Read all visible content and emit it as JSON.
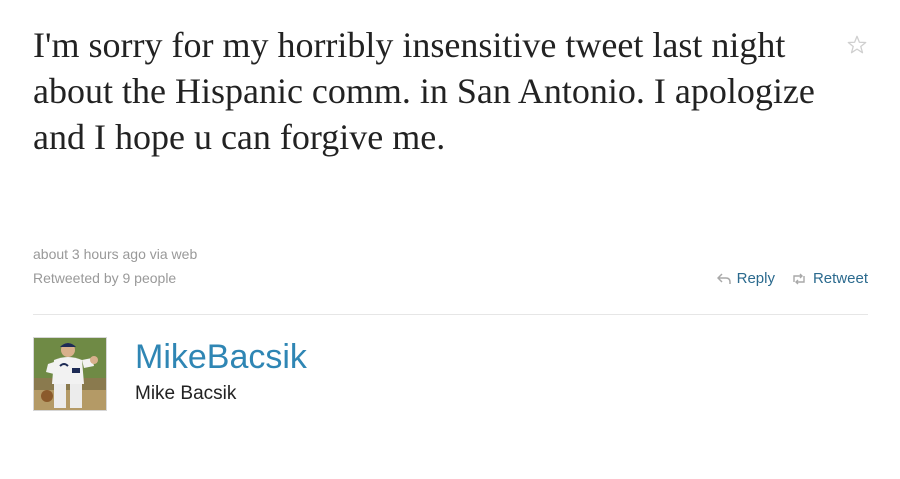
{
  "tweet": {
    "text": "I'm sorry for my horribly insensitive tweet last night about the Hispanic comm. in San Antonio. I apologize and I hope u can forgive me.",
    "timestamp": "about 3 hours ago via web",
    "retweeted_by": "Retweeted by 9 people"
  },
  "actions": {
    "reply_label": "Reply",
    "retweet_label": "Retweet"
  },
  "author": {
    "screen_name": "MikeBacsik",
    "full_name": "Mike Bacsik"
  },
  "icons": {
    "favorite": "star-icon",
    "reply": "reply-arrow-icon",
    "retweet": "retweet-icon"
  },
  "colors": {
    "link": "#2f86b4",
    "action": "#2b6a8e",
    "meta": "#999999",
    "text": "#222222"
  }
}
